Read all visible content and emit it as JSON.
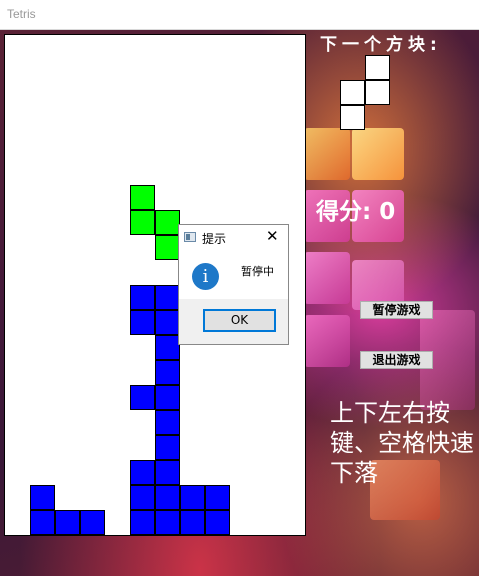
{
  "window": {
    "title": "Tetris"
  },
  "next_piece": {
    "label": "下一个方块:",
    "cells": [
      [
        1,
        0
      ],
      [
        0,
        1
      ],
      [
        1,
        1
      ],
      [
        0,
        2
      ]
    ],
    "color": "#ffffff"
  },
  "score": {
    "label": "得分: ",
    "value": "0"
  },
  "buttons": {
    "pause": "暂停游戏",
    "exit": "退出游戏"
  },
  "help_text": "上下左右按键、空格快速下落",
  "board": {
    "columns": 12,
    "rows": 20,
    "falling_piece": {
      "color": "#00ff00",
      "cells": [
        [
          5,
          6
        ],
        [
          5,
          7
        ],
        [
          6,
          7
        ],
        [
          6,
          8
        ]
      ]
    },
    "stack": {
      "color": "#0000ff",
      "cells": [
        [
          5,
          10
        ],
        [
          6,
          10
        ],
        [
          5,
          11
        ],
        [
          6,
          11
        ],
        [
          6,
          12
        ],
        [
          6,
          13
        ],
        [
          5,
          14
        ],
        [
          6,
          14
        ],
        [
          6,
          15
        ],
        [
          6,
          16
        ],
        [
          5,
          17
        ],
        [
          6,
          17
        ],
        [
          5,
          18
        ],
        [
          6,
          18
        ],
        [
          7,
          18
        ],
        [
          8,
          18
        ],
        [
          5,
          19
        ],
        [
          6,
          19
        ],
        [
          7,
          19
        ],
        [
          8,
          19
        ],
        [
          1,
          18
        ],
        [
          1,
          19
        ],
        [
          2,
          19
        ],
        [
          3,
          19
        ]
      ]
    }
  },
  "dialog": {
    "title": "提示",
    "close": "✕",
    "icon": "info-icon",
    "message": "暂停中",
    "ok": "OK"
  },
  "colors": {
    "stack": "#0000ff",
    "falling": "#00ff00",
    "info": "#1e78c8"
  }
}
